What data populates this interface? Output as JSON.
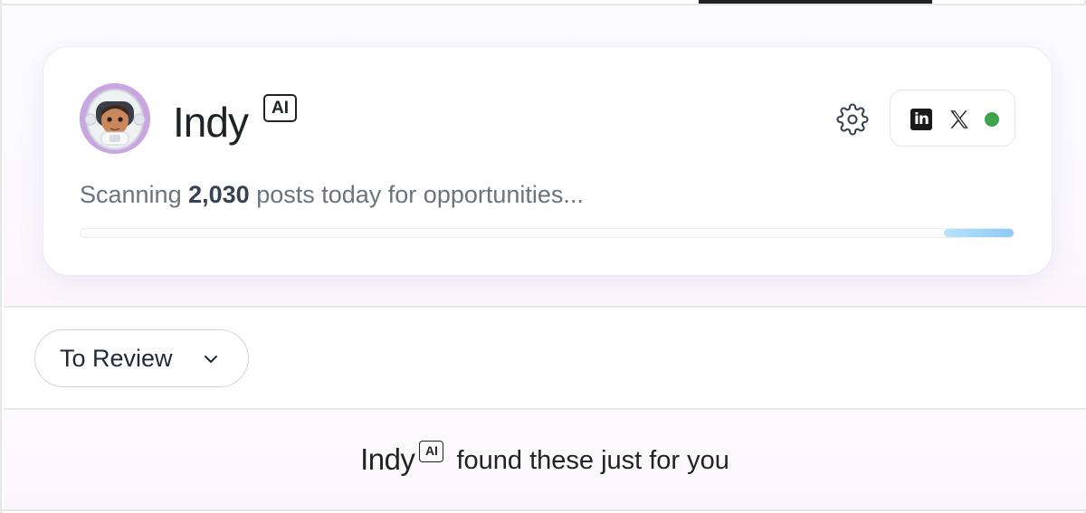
{
  "header": {
    "brand_name": "Indy",
    "ai_badge": "AI",
    "avatar": "astronaut-avatar",
    "settings_icon": "gear-icon",
    "connected_networks": [
      "linkedin-icon",
      "x-icon"
    ],
    "connection_status_color": "#3fa34d"
  },
  "scan": {
    "prefix": "Scanning",
    "count": "2,030",
    "suffix": "posts today for opportunities...",
    "progress": {
      "value_start_fraction": 0.925,
      "value_end_fraction": 1.0
    }
  },
  "filter": {
    "selected": "To Review",
    "icon": "chevron-down-icon"
  },
  "footer": {
    "brand_name": "Indy",
    "ai_badge": "AI",
    "text": "found these just for you"
  },
  "colors": {
    "progress_fill": "#8ccaf6",
    "text_primary": "#1f2328",
    "text_muted": "#6b7380"
  }
}
